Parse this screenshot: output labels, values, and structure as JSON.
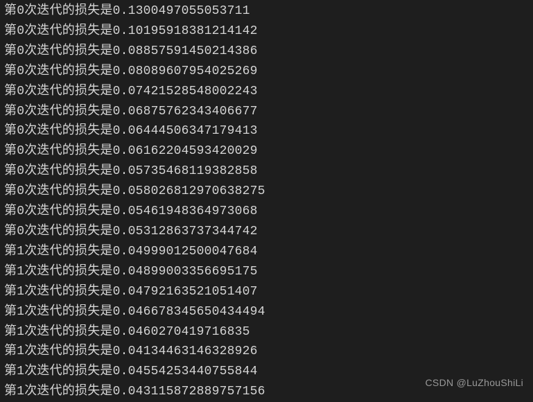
{
  "log_prefix": "第",
  "log_middle": "次迭代的损失是",
  "lines": [
    {
      "iteration": "0",
      "loss": "0.1300497055053711"
    },
    {
      "iteration": "0",
      "loss": "0.10195918381214142"
    },
    {
      "iteration": "0",
      "loss": "0.08857591450214386"
    },
    {
      "iteration": "0",
      "loss": "0.08089607954025269"
    },
    {
      "iteration": "0",
      "loss": "0.07421528548002243"
    },
    {
      "iteration": "0",
      "loss": "0.06875762343406677"
    },
    {
      "iteration": "0",
      "loss": "0.06444506347179413"
    },
    {
      "iteration": "0",
      "loss": "0.06162204593420029"
    },
    {
      "iteration": "0",
      "loss": "0.05735468119382858"
    },
    {
      "iteration": "0",
      "loss": "0.058026812970638275"
    },
    {
      "iteration": "0",
      "loss": "0.05461948364973068"
    },
    {
      "iteration": "0",
      "loss": "0.05312863737344742"
    },
    {
      "iteration": "1",
      "loss": "0.04999012500047684"
    },
    {
      "iteration": "1",
      "loss": "0.04899003356695175"
    },
    {
      "iteration": "1",
      "loss": "0.04792163521051407"
    },
    {
      "iteration": "1",
      "loss": "0.046678345650434494"
    },
    {
      "iteration": "1",
      "loss": "0.0460270419716835"
    },
    {
      "iteration": "1",
      "loss": "0.04134463146328926"
    },
    {
      "iteration": "1",
      "loss": "0.04554253440755844"
    },
    {
      "iteration": "1",
      "loss": "0.043115872889757156"
    }
  ],
  "watermark": "CSDN @LuZhouShiLi"
}
